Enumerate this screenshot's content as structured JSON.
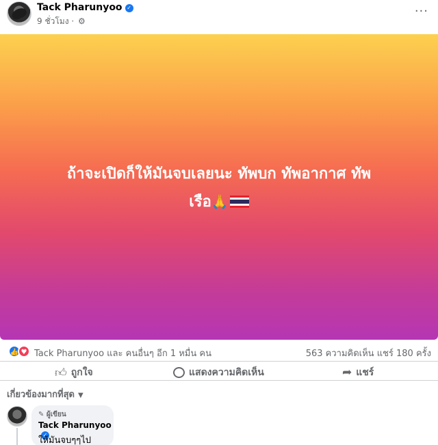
{
  "post": {
    "author": "Tack Pharunyoo",
    "time": "9 ชั่วโมง",
    "separator": "·",
    "more_menu": "···",
    "text_line1": "ถ้าจะเปิดก็ให้มันจบเลยนะ ทัพบก ทัพอากาศ ทัพ",
    "text_line2": "เรือ",
    "text_emoji": "🙏",
    "gradient_colors": [
      "#fdd14f",
      "#f56b52",
      "#b536b4"
    ]
  },
  "reactions": {
    "names": "Tack Pharunyoo และ คนอื่นๆ อีก 1 หมื่น คน",
    "stats": "563 ความคิดเห็น   แชร์ 180 ครั้ง",
    "like_color": "#1877f2",
    "love_color": "#f33e58"
  },
  "actions": {
    "like": "ถูกใจ",
    "comment": "แสดงความคิดเห็น",
    "share": "แชร์"
  },
  "filter": {
    "label": "เกี่ยวข้องมากที่สุด"
  },
  "comment": {
    "badge": "ผู้เขียน",
    "author": "Tack Pharunyoo",
    "text": "ให้มันจบๆๆไป"
  },
  "icons": [
    "verified-icon",
    "gear-icon",
    "more-icon",
    "like-icon",
    "comment-icon",
    "share-icon",
    "caret-icon",
    "pencil-icon"
  ]
}
